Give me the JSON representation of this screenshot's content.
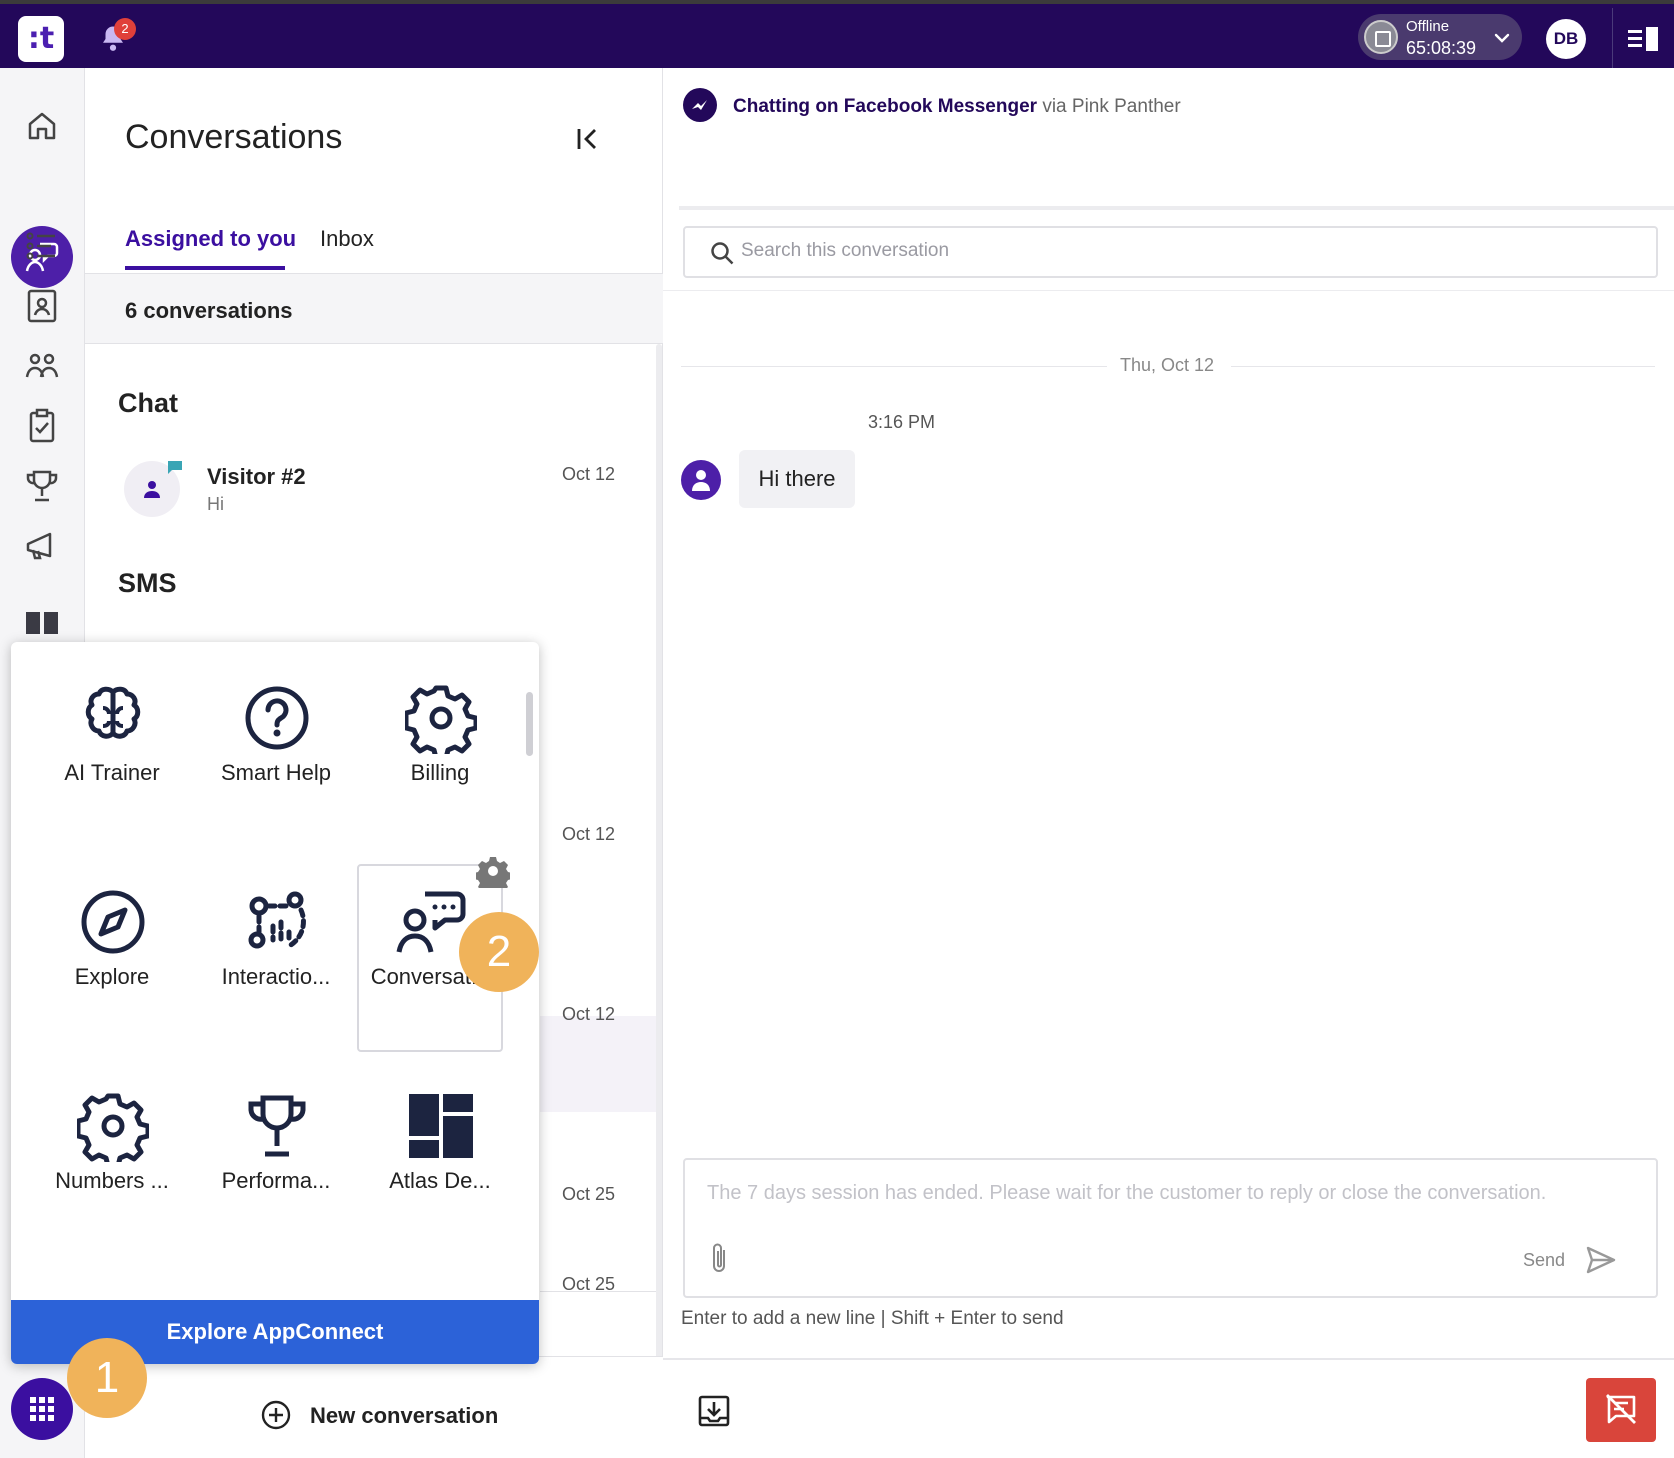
{
  "topbar": {
    "logo_text": ":t",
    "notification_count": "2",
    "status": {
      "label": "Offline",
      "timer": "65:08:39"
    },
    "user_initials": "DB"
  },
  "leftnav": {
    "items": [
      {
        "name": "home-icon"
      },
      {
        "name": "conversations-icon",
        "active": true
      },
      {
        "name": "list-icon"
      },
      {
        "name": "contacts-icon"
      },
      {
        "name": "teams-icon"
      },
      {
        "name": "tasks-icon"
      },
      {
        "name": "trophy-icon"
      },
      {
        "name": "megaphone-icon"
      },
      {
        "name": "dashboard-icon"
      }
    ]
  },
  "conversations": {
    "title": "Conversations",
    "tabs": [
      {
        "label": "Assigned to you",
        "active": true
      },
      {
        "label": "Inbox",
        "active": false
      }
    ],
    "count_label": "6 conversations",
    "sections": [
      {
        "heading": "Chat"
      },
      {
        "heading": "SMS"
      }
    ],
    "items": [
      {
        "name": "Visitor #2",
        "preview": "Hi",
        "date": "Oct 12"
      },
      {
        "date": "Oct 12"
      },
      {
        "date": "Oct 12"
      },
      {
        "date": "Oct 25"
      },
      {
        "date": "Oct 25"
      }
    ],
    "new_conversation_label": "New conversation"
  },
  "launcher": {
    "apps": [
      {
        "label": "AI Trainer",
        "icon": "brain-icon"
      },
      {
        "label": "Smart Help",
        "icon": "help-circle-icon"
      },
      {
        "label": "Billing",
        "icon": "gear-icon"
      },
      {
        "label": "Explore",
        "icon": "compass-icon"
      },
      {
        "label": "Interactio...",
        "icon": "interactions-icon"
      },
      {
        "label": "Conversat...",
        "icon": "conversations-app-icon"
      },
      {
        "label": "Numbers ...",
        "icon": "gear-icon"
      },
      {
        "label": "Performa...",
        "icon": "trophy-icon"
      },
      {
        "label": "Atlas De...",
        "icon": "dashboard-icon"
      }
    ],
    "explore_button_label": "Explore AppConnect",
    "step_markers": [
      "1",
      "2"
    ]
  },
  "chat": {
    "header": {
      "channel": "Chatting on Facebook Messenger",
      "via": "via Pink Panther"
    },
    "search_placeholder": "Search this conversation",
    "date_divider": "Thu, Oct 12",
    "messages": [
      {
        "time": "3:16 PM",
        "text": "Hi there"
      }
    ],
    "composer_placeholder": "The 7 days session has ended. Please wait for the customer to reply or close the conversation.",
    "send_label": "Send",
    "hint": "Enter to add a new line | Shift + Enter to send"
  },
  "colors": {
    "topbar": "#23085a",
    "accent": "#3b0fa0",
    "explore_button": "#2c62d8",
    "step_marker": "#f0b35a",
    "end_chat": "#d9453b"
  }
}
